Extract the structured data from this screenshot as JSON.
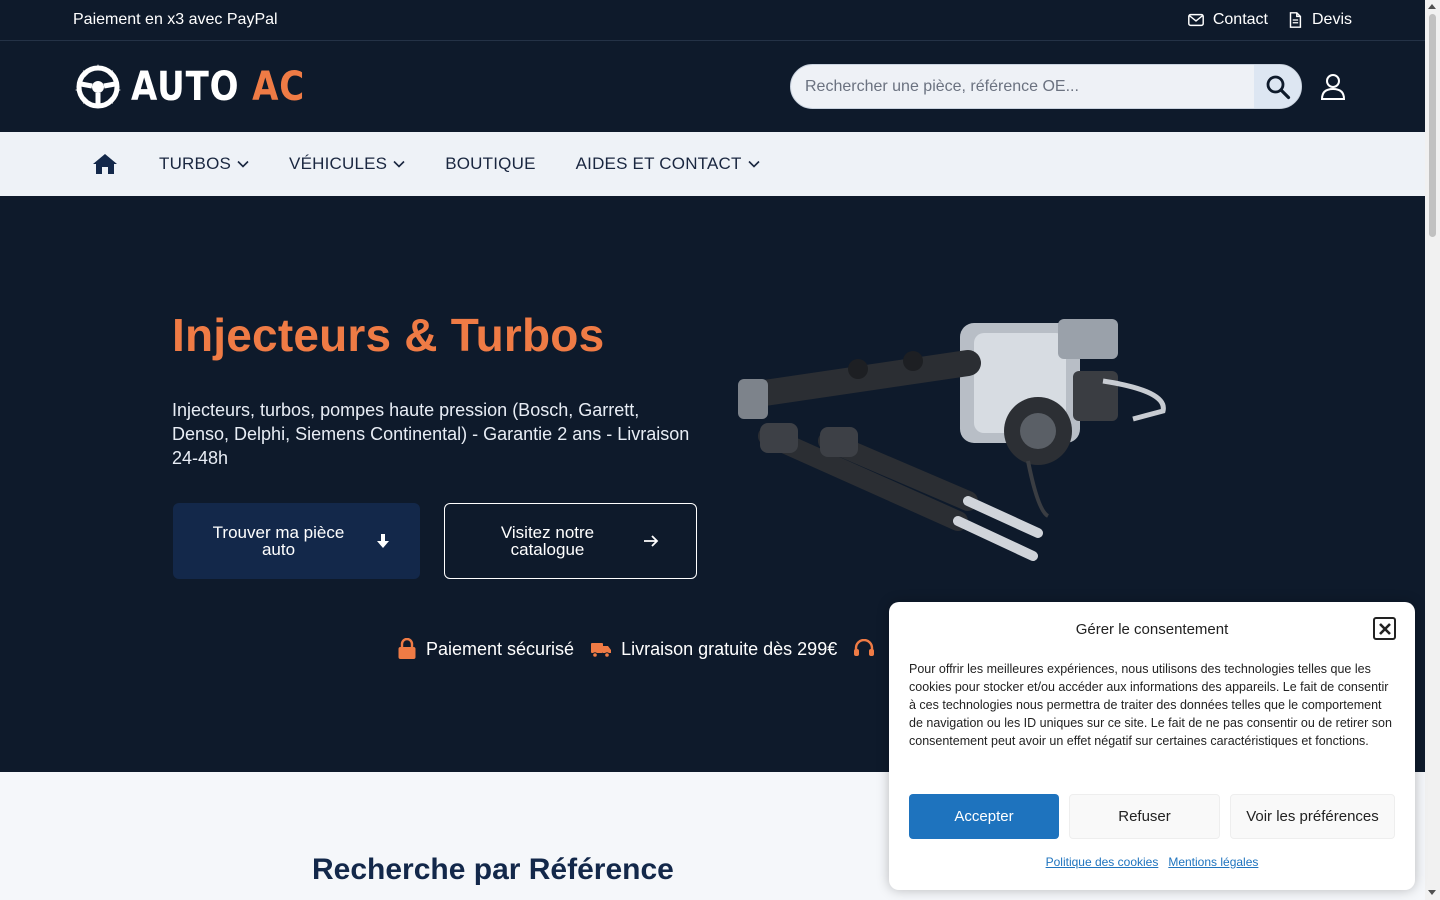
{
  "topbar": {
    "promo": "Paiement en x3 avec PayPal",
    "contact_label": "Contact",
    "quote_label": "Devis"
  },
  "header": {
    "logo_word1": "AUTO",
    "logo_word2": "AC",
    "search_placeholder": "Rechercher une pièce, référence OE..."
  },
  "nav": {
    "items": [
      {
        "label": "TURBOS",
        "dropdown": true
      },
      {
        "label": "VÉHICULES",
        "dropdown": true
      },
      {
        "label": "BOUTIQUE",
        "dropdown": false
      },
      {
        "label": "AIDES ET CONTACT",
        "dropdown": true
      }
    ]
  },
  "hero": {
    "title": "Injecteurs & Turbos",
    "description": "Injecteurs, turbos, pompes haute pression (Bosch, Garrett, Denso, Delphi, Siemens Continental) - Garantie 2 ans - Livraison 24-48h",
    "primary_button": "Trouver ma pièce auto",
    "secondary_button": "Visitez notre catalogue",
    "trust": {
      "secure": "Paiement sécurisé",
      "shipping": "Livraison gratuite dès 299€"
    }
  },
  "section": {
    "ref_title": "Recherche par Référence"
  },
  "consent": {
    "title": "Gérer le consentement",
    "text": "Pour offrir les meilleures expériences, nous utilisons des technologies telles que les cookies pour stocker et/ou accéder aux informations des appareils. Le fait de consentir à ces technologies nous permettra de traiter des données telles que le comportement de navigation ou les ID uniques sur ce site. Le fait de ne pas consentir ou de retirer son consentement peut avoir un effet négatif sur certaines caractéristiques et fonctions.",
    "accept": "Accepter",
    "refuse": "Refuser",
    "preferences": "Voir les préférences",
    "cookie_policy": "Politique des cookies",
    "legal": "Mentions légales"
  },
  "colors": {
    "dark": "#0e1a2b",
    "accent": "#ef7b45",
    "primary_button": "#13284a",
    "accept": "#1e73be"
  }
}
